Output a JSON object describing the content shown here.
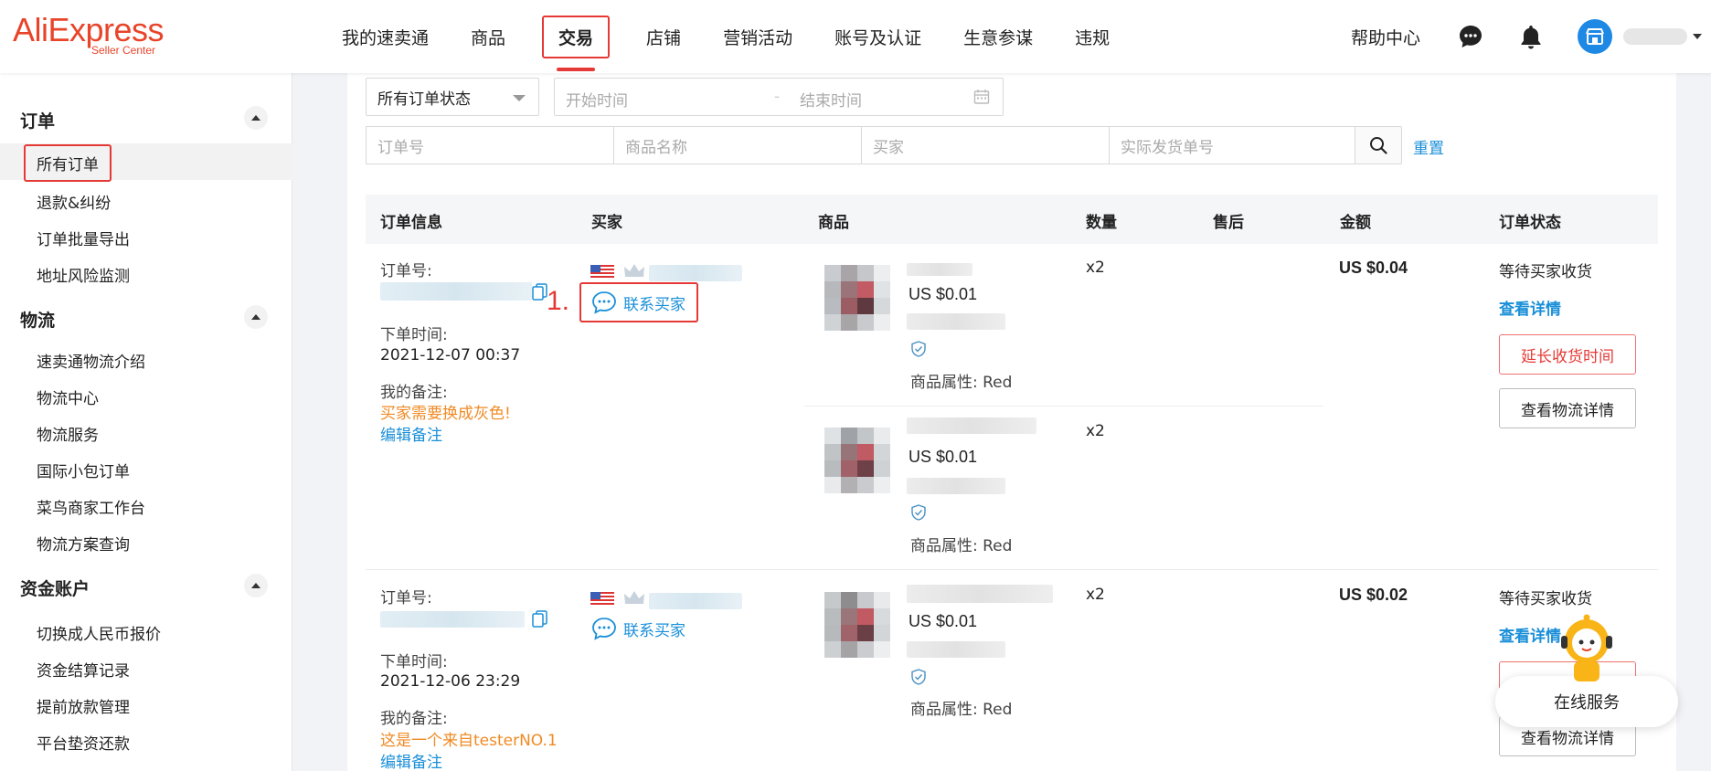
{
  "header": {
    "logo_main": "AliExpress",
    "logo_sub": "Seller Center",
    "nav": [
      "我的速卖通",
      "商品",
      "交易",
      "店铺",
      "营销活动",
      "账号及认证",
      "生意参谋",
      "违规"
    ],
    "help": "帮助中心",
    "icons": [
      "chat-icon",
      "bell-icon",
      "store-icon"
    ]
  },
  "sidebar": {
    "order_title": "订单",
    "order_items": [
      "所有订单",
      "退款&纠纷",
      "订单批量导出",
      "地址风险监测"
    ],
    "logistics_title": "物流",
    "logistics_items": [
      "速卖通物流介绍",
      "物流中心",
      "物流服务",
      "国际小包订单",
      "菜鸟商家工作台",
      "物流方案查询"
    ],
    "funds_title": "资金账户",
    "funds_items": [
      "切换成人民币报价",
      "资金结算记录",
      "提前放款管理",
      "平台垫资还款"
    ]
  },
  "filters": {
    "status_select": "所有订单状态",
    "start_time": "开始时间",
    "date_sep": "-",
    "end_time": "结束时间",
    "order_no": "订单号",
    "product_name": "商品名称",
    "buyer": "买家",
    "tracking_no": "实际发货单号",
    "reset": "重置"
  },
  "table": {
    "headers": [
      "订单信息",
      "买家",
      "商品",
      "数量",
      "售后",
      "金额",
      "订单状态"
    ],
    "orders": [
      {
        "order_no_label": "订单号:",
        "time_label": "下单时间:",
        "time": "2021-12-07 00:37",
        "note_label": "我的备注:",
        "note": "买家需要换成灰色!",
        "edit_note": "编辑备注",
        "contact": "联系买家",
        "step": "1.",
        "items": [
          {
            "price": "US $0.01",
            "attr": "商品属性: Red",
            "qty": "x2"
          },
          {
            "price": "US $0.01",
            "attr": "商品属性: Red",
            "qty": "x2"
          }
        ],
        "amount": "US $0.04",
        "status": "等待买家收货",
        "view_detail": "查看详情",
        "extend_btn": "延长收货时间",
        "logistics_btn": "查看物流详情"
      },
      {
        "order_no_label": "订单号:",
        "time_label": "下单时间:",
        "time": "2021-12-06 23:29",
        "note_label": "我的备注:",
        "note": "这是一个来自testerNO.1",
        "edit_note": "编辑备注",
        "contact": "联系买家",
        "items": [
          {
            "price": "US $0.01",
            "attr": "商品属性: Red",
            "qty": "x2"
          }
        ],
        "amount": "US $0.02",
        "status": "等待买家收货",
        "view_detail": "查看详情",
        "logistics_btn": "查看物流详情"
      }
    ]
  },
  "service": {
    "label": "在线服务"
  },
  "colors": {
    "brand": "#e8442a",
    "accent_red": "#e53935",
    "link_blue": "#1a8fd8",
    "remark_orange": "#f08a24"
  }
}
